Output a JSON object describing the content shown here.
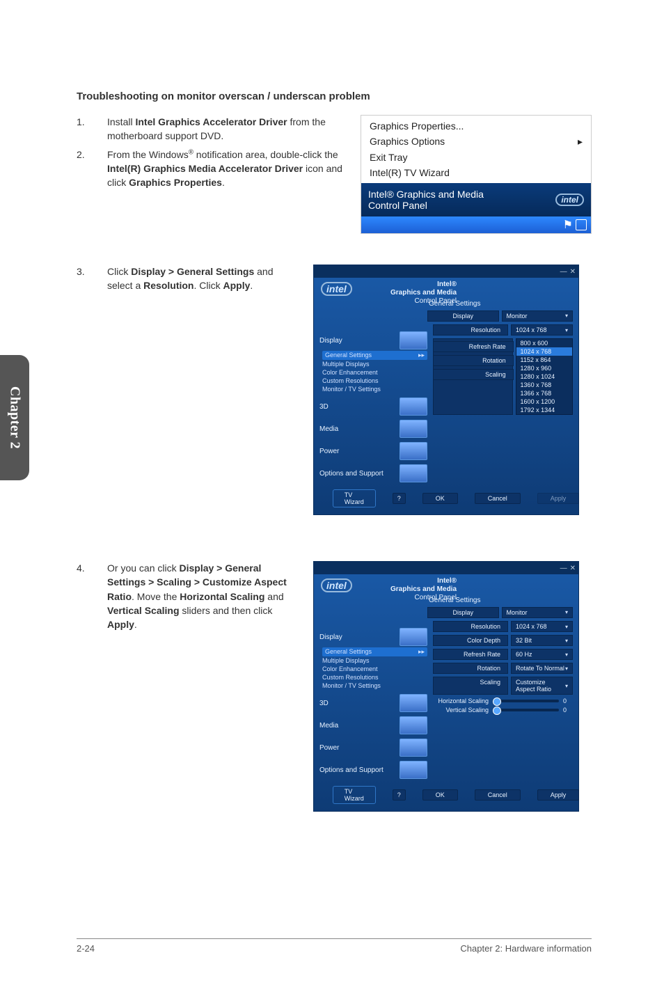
{
  "section_title": "Troubleshooting on monitor overscan / underscan problem",
  "step1_num": "1.",
  "step1_pre": "Install ",
  "step1_b1": "Intel Graphics Accelerator Driver",
  "step1_post": " from the motherboard support DVD.",
  "step2_num": "2.",
  "step2_pre": "From the Windows",
  "step2_sup": "®",
  "step2_mid1": " notification area, double-click the ",
  "step2_b1": "Intel(R) Graphics Media Accelerator Driver",
  "step2_mid2": " icon and click ",
  "step2_b2": "Graphics Properties",
  "step2_post": ".",
  "step3_num": "3.",
  "step3_pre": "Click ",
  "step3_b1": "Display > General Settings",
  "step3_mid1": " and select a ",
  "step3_b2": "Resolution",
  "step3_mid2": ". Click ",
  "step3_b3": "Apply",
  "step3_post": ".",
  "step4_num": "4.",
  "step4_pre": "Or you can click ",
  "step4_b1": "Display > General Settings > Scaling > Customize Aspect Ratio",
  "step4_mid1": ". Move the ",
  "step4_b2": "Horizontal Scaling",
  "step4_mid2": " and ",
  "step4_b3": "Vertical Scaling",
  "step4_mid3": " sliders and then click ",
  "step4_b4": "Apply",
  "step4_post": ".",
  "ctx": {
    "items": [
      "Graphics Properties...",
      "Graphics Options",
      "Exit Tray",
      "Intel(R) TV Wizard"
    ],
    "arrow": "▸",
    "panel_title": "Intel® Graphics and Media Control Panel",
    "intel": "intel"
  },
  "cp": {
    "intel": "intel",
    "brand_line1": "Intel®",
    "brand_line2": "Graphics and Media",
    "brand_line3": "Control Panel",
    "tab_section": "General Settings",
    "tab_display": "Display",
    "tab_monitor": "Monitor",
    "side": {
      "cat_display": "Display",
      "items_display": [
        "General Settings",
        "Multiple Displays",
        "Color Enhancement",
        "Custom Resolutions",
        "Monitor / TV Settings"
      ],
      "arrow": "▸▸",
      "cat_3d": "3D",
      "cat_media": "Media",
      "cat_power": "Power",
      "cat_options": "Options and Support"
    },
    "rows": {
      "resolution": "Resolution",
      "color_depth": "Color Depth",
      "refresh": "Refresh Rate",
      "rotation": "Rotation",
      "scaling": "Scaling"
    },
    "vals3": {
      "resolution": "1024 x 768",
      "dropdown": [
        "800 x 600",
        "1024 x 768",
        "1152 x 864",
        "1280 x 960",
        "1280 x 1024",
        "1360 x 768",
        "1366 x 768",
        "1600 x 1200",
        "1792 x 1344"
      ]
    },
    "vals4": {
      "resolution": "1024 x 768",
      "color_depth": "32 Bit",
      "refresh": "60 Hz",
      "rotation": "Rotate To Normal",
      "scaling": "Customize Aspect Ratio",
      "hscale_label": "Horizontal Scaling",
      "vscale_label": "Vertical Scaling",
      "hscale_val": "0",
      "vscale_val": "0"
    },
    "footer": {
      "wizard": "TV Wizard",
      "q": "?",
      "ok": "OK",
      "cancel": "Cancel",
      "apply": "Apply"
    }
  },
  "sidetab": "Chapter 2",
  "footer_left": "2-24",
  "footer_right": "Chapter 2: Hardware information"
}
